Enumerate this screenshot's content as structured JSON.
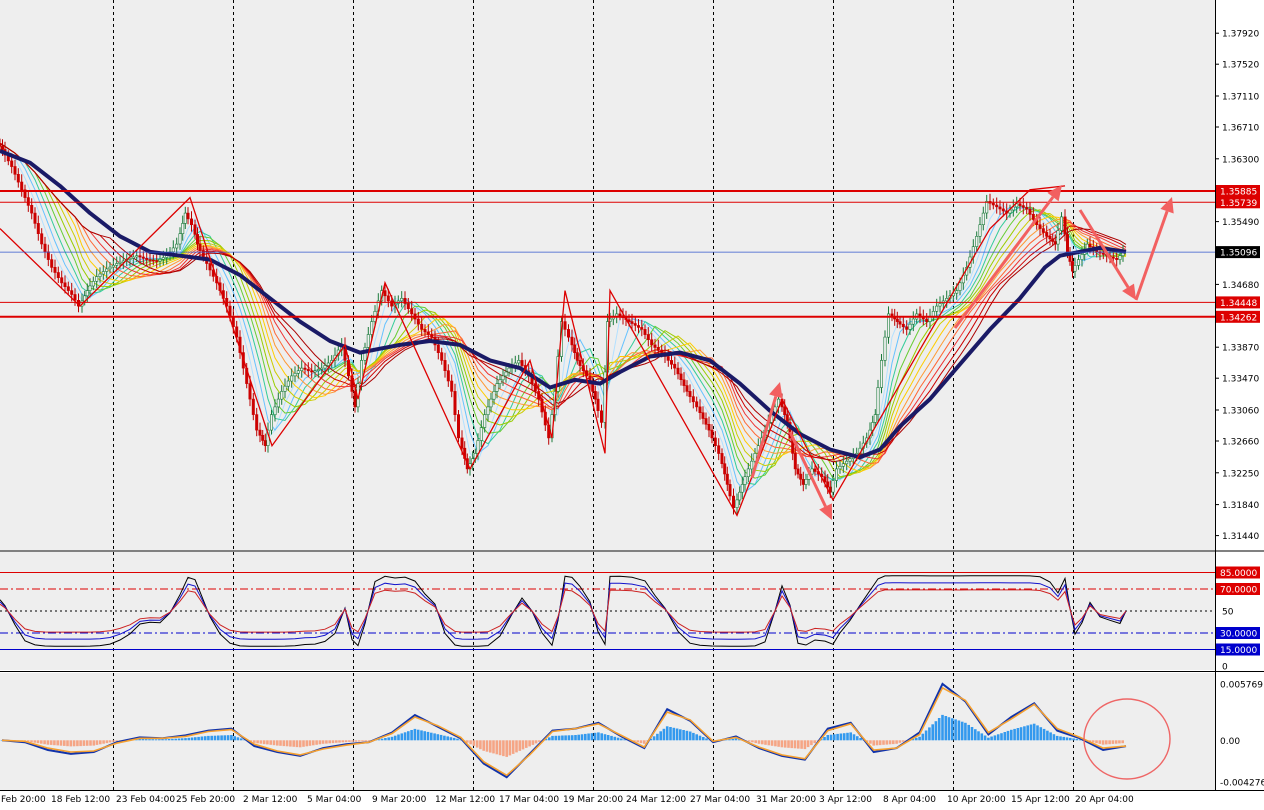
{
  "chart_data": {
    "type": "candlestick",
    "instrument_note": "",
    "main_axis": {
      "ticks": [
        "1.37920",
        "1.37520",
        "1.37110",
        "1.36710",
        "1.36300",
        "1.35490",
        "1.34680",
        "1.33870",
        "1.33470",
        "1.33060",
        "1.32660",
        "1.32250",
        "1.31840",
        "1.31440"
      ],
      "ylim": [
        1.3128,
        1.3809
      ]
    },
    "price_labels": [
      {
        "value": "1.35885",
        "color": "#dd0000",
        "line": "horizontal-red"
      },
      {
        "value": "1.35739",
        "color": "#dd0000",
        "line": "horizontal-red-thin"
      },
      {
        "value": "1.35096",
        "color": "#000000",
        "line": "current-price"
      },
      {
        "value": "1.34448",
        "color": "#dd0000",
        "line": "horizontal-red-thin"
      },
      {
        "value": "1.34262",
        "color": "#dd0000",
        "line": "horizontal-red"
      }
    ],
    "x_labels": [
      "Feb 20:00",
      "18 Feb 12:00",
      "23 Feb 04:00",
      "25 Feb 20:00",
      "2 Mar 12:00",
      "5 Mar 04:00",
      "9 Mar 20:00",
      "12 Mar 12:00",
      "17 Mar 04:00",
      "19 Mar 20:00",
      "24 Mar 12:00",
      "27 Mar 04:00",
      "31 Mar 20:00",
      "3 Apr 12:00",
      "8 Apr 04:00",
      "10 Apr 20:00",
      "15 Apr 12:00",
      "20 Apr 04:00"
    ],
    "price_path": [
      [
        0,
        1.365
      ],
      [
        5,
        1.3642
      ],
      [
        15,
        1.362
      ],
      [
        25,
        1.359
      ],
      [
        35,
        1.356
      ],
      [
        45,
        1.352
      ],
      [
        55,
        1.349
      ],
      [
        65,
        1.347
      ],
      [
        75,
        1.3455
      ],
      [
        82,
        1.344
      ],
      [
        90,
        1.346
      ],
      [
        100,
        1.3478
      ],
      [
        110,
        1.3488
      ],
      [
        120,
        1.3495
      ],
      [
        130,
        1.35
      ],
      [
        140,
        1.3505
      ],
      [
        150,
        1.35
      ],
      [
        160,
        1.3498
      ],
      [
        170,
        1.3505
      ],
      [
        180,
        1.352
      ],
      [
        188,
        1.356
      ],
      [
        195,
        1.3545
      ],
      [
        200,
        1.352
      ],
      [
        210,
        1.3495
      ],
      [
        220,
        1.347
      ],
      [
        230,
        1.344
      ],
      [
        240,
        1.34
      ],
      [
        250,
        1.334
      ],
      [
        260,
        1.328
      ],
      [
        268,
        1.326
      ],
      [
        275,
        1.33
      ],
      [
        285,
        1.333
      ],
      [
        295,
        1.335
      ],
      [
        305,
        1.336
      ],
      [
        315,
        1.3355
      ],
      [
        325,
        1.336
      ],
      [
        335,
        1.337
      ],
      [
        345,
        1.339
      ],
      [
        352,
        1.335
      ],
      [
        358,
        1.331
      ],
      [
        365,
        1.337
      ],
      [
        375,
        1.342
      ],
      [
        385,
        1.346
      ],
      [
        395,
        1.344
      ],
      [
        405,
        1.345
      ],
      [
        415,
        1.343
      ],
      [
        425,
        1.341
      ],
      [
        435,
        1.34
      ],
      [
        445,
        1.337
      ],
      [
        455,
        1.333
      ],
      [
        462,
        1.327
      ],
      [
        470,
        1.323
      ],
      [
        478,
        1.325
      ],
      [
        488,
        1.33
      ],
      [
        500,
        1.334
      ],
      [
        512,
        1.336
      ],
      [
        522,
        1.337
      ],
      [
        532,
        1.335
      ],
      [
        542,
        1.332
      ],
      [
        552,
        1.327
      ],
      [
        558,
        1.333
      ],
      [
        565,
        1.342
      ],
      [
        572,
        1.34
      ],
      [
        580,
        1.337
      ],
      [
        590,
        1.335
      ],
      [
        598,
        1.332
      ],
      [
        605,
        1.329
      ],
      [
        610,
        1.342
      ],
      [
        620,
        1.343
      ],
      [
        632,
        1.342
      ],
      [
        645,
        1.341
      ],
      [
        655,
        1.339
      ],
      [
        665,
        1.338
      ],
      [
        678,
        1.336
      ],
      [
        690,
        1.333
      ],
      [
        700,
        1.331
      ],
      [
        712,
        1.328
      ],
      [
        722,
        1.325
      ],
      [
        730,
        1.321
      ],
      [
        737,
        1.318
      ],
      [
        745,
        1.321
      ],
      [
        755,
        1.324
      ],
      [
        765,
        1.327
      ],
      [
        775,
        1.33
      ],
      [
        782,
        1.332
      ],
      [
        790,
        1.329
      ],
      [
        798,
        1.323
      ],
      [
        806,
        1.321
      ],
      [
        815,
        1.323
      ],
      [
        825,
        1.322
      ],
      [
        833,
        1.32
      ],
      [
        840,
        1.323
      ],
      [
        850,
        1.324
      ],
      [
        860,
        1.325
      ],
      [
        870,
        1.327
      ],
      [
        878,
        1.33
      ],
      [
        885,
        1.337
      ],
      [
        892,
        1.343
      ],
      [
        900,
        1.342
      ],
      [
        910,
        1.341
      ],
      [
        920,
        1.343
      ],
      [
        930,
        1.342
      ],
      [
        940,
        1.344
      ],
      [
        950,
        1.345
      ],
      [
        960,
        1.346
      ],
      [
        970,
        1.349
      ],
      [
        980,
        1.353
      ],
      [
        990,
        1.3575
      ],
      [
        1000,
        1.3568
      ],
      [
        1010,
        1.356
      ],
      [
        1020,
        1.3572
      ],
      [
        1030,
        1.3565
      ],
      [
        1040,
        1.3545
      ],
      [
        1050,
        1.353
      ],
      [
        1058,
        1.352
      ],
      [
        1065,
        1.3555
      ],
      [
        1070,
        1.351
      ],
      [
        1075,
        1.3485
      ],
      [
        1082,
        1.35
      ],
      [
        1090,
        1.352
      ],
      [
        1100,
        1.351
      ],
      [
        1110,
        1.3505
      ],
      [
        1120,
        1.35
      ],
      [
        1126,
        1.351
      ]
    ],
    "heavy_ma_path": [
      [
        0,
        1.364
      ],
      [
        30,
        1.3625
      ],
      [
        60,
        1.3595
      ],
      [
        90,
        1.356
      ],
      [
        120,
        1.353
      ],
      [
        150,
        1.351
      ],
      [
        180,
        1.3505
      ],
      [
        210,
        1.35
      ],
      [
        240,
        1.348
      ],
      [
        270,
        1.345
      ],
      [
        300,
        1.342
      ],
      [
        330,
        1.3395
      ],
      [
        360,
        1.338
      ],
      [
        380,
        1.3385
      ],
      [
        400,
        1.339
      ],
      [
        430,
        1.3395
      ],
      [
        460,
        1.339
      ],
      [
        490,
        1.337
      ],
      [
        520,
        1.336
      ],
      [
        550,
        1.3335
      ],
      [
        575,
        1.3345
      ],
      [
        600,
        1.334
      ],
      [
        620,
        1.3355
      ],
      [
        650,
        1.3375
      ],
      [
        680,
        1.338
      ],
      [
        710,
        1.337
      ],
      [
        740,
        1.334
      ],
      [
        770,
        1.3305
      ],
      [
        800,
        1.3275
      ],
      [
        830,
        1.3255
      ],
      [
        860,
        1.3245
      ],
      [
        880,
        1.3255
      ],
      [
        900,
        1.3285
      ],
      [
        930,
        1.332
      ],
      [
        960,
        1.3365
      ],
      [
        990,
        1.341
      ],
      [
        1020,
        1.345
      ],
      [
        1045,
        1.349
      ],
      [
        1060,
        1.3505
      ],
      [
        1080,
        1.351
      ],
      [
        1100,
        1.3515
      ],
      [
        1126,
        1.351
      ]
    ],
    "zigzag_path": [
      [
        0,
        1.354
      ],
      [
        80,
        1.344
      ],
      [
        190,
        1.358
      ],
      [
        272,
        1.326
      ],
      [
        345,
        1.339
      ],
      [
        358,
        1.332
      ],
      [
        385,
        1.347
      ],
      [
        470,
        1.323
      ],
      [
        530,
        1.337
      ],
      [
        552,
        1.327
      ],
      [
        565,
        1.346
      ],
      [
        605,
        1.325
      ],
      [
        610,
        1.346
      ],
      [
        737,
        1.317
      ],
      [
        782,
        1.332
      ],
      [
        833,
        1.319
      ],
      [
        990,
        1.354
      ],
      [
        1030,
        1.359
      ],
      [
        1065,
        1.3595
      ]
    ],
    "rsi_panel": {
      "levels": [
        {
          "value": "85.0000",
          "color": "#dd0000"
        },
        {
          "value": "70.0000",
          "color": "#dd0000"
        },
        {
          "value": "50",
          "color": "#000000"
        },
        {
          "value": "30.0000",
          "color": "#0000cc"
        },
        {
          "value": "15.0000",
          "color": "#0000cc"
        },
        {
          "value": "0",
          "color": "#000000"
        }
      ]
    },
    "macd_panel": {
      "ticks": [
        "0.005769",
        "0.00",
        "-0.004276"
      ],
      "ylim": [
        -0.0047,
        0.0062
      ],
      "series": [
        {
          "values": [
            0.0,
            -0.0002,
            -0.001,
            -0.0014,
            -0.0012,
            -0.0002,
            0.0003,
            0.0002,
            0.0005,
            0.001,
            0.0012,
            -0.0006,
            -0.0012,
            -0.0016,
            -0.0008,
            -0.0004,
            -0.0002,
            0.0008,
            0.0026,
            0.0014,
            0.0002,
            -0.0024,
            -0.0038,
            -0.0014,
            0.001,
            0.0012,
            0.0018,
            0.0004,
            -0.0008,
            0.0032,
            0.002,
            -0.0002,
            0.0004,
            -0.0008,
            -0.0016,
            -0.002,
            0.0012,
            0.0018,
            -0.0012,
            -0.0008,
            0.0008,
            0.0058,
            0.004,
            0.0006,
            0.0024,
            0.0038,
            0.001,
            0.0002,
            -0.001,
            -0.0006
          ]
        },
        {
          "values": [
            0.0,
            -0.0001,
            -0.0008,
            -0.0012,
            -0.0011,
            -0.0003,
            0.0002,
            0.0002,
            0.0004,
            0.0009,
            0.0011,
            -0.0004,
            -0.0011,
            -0.0015,
            -0.0009,
            -0.0005,
            -0.0002,
            0.0007,
            0.0024,
            0.0015,
            0.0003,
            -0.0022,
            -0.0036,
            -0.0015,
            0.0009,
            0.0012,
            0.0017,
            0.0005,
            -0.0007,
            0.0029,
            0.0021,
            -0.0001,
            0.0003,
            -0.0007,
            -0.0015,
            -0.0019,
            0.001,
            0.0017,
            -0.001,
            -0.0008,
            0.0006,
            0.0054,
            0.0041,
            0.0008,
            0.0022,
            0.0037,
            0.0012,
            0.0003,
            -0.0008,
            -0.0006
          ]
        }
      ]
    }
  }
}
